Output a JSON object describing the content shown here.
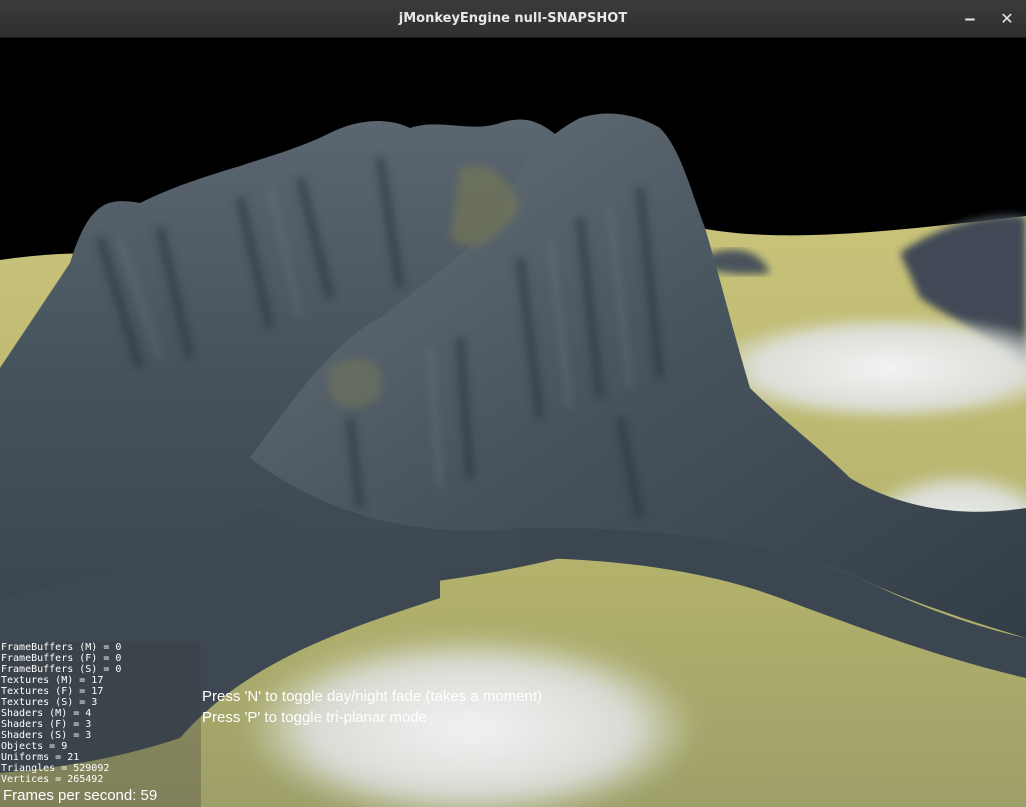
{
  "window": {
    "title": "jMonkeyEngine null-SNAPSHOT",
    "minimize_icon": "minimize-icon",
    "close_icon": "close-icon",
    "minimize_glyph": "‒",
    "close_glyph": "✕"
  },
  "stats": [
    "FrameBuffers (M) = 0",
    "FrameBuffers (F) = 0",
    "FrameBuffers (S) = 0",
    "Textures (M) = 17",
    "Textures (F) = 17",
    "Textures (S) = 3",
    "Shaders (M) = 4",
    "Shaders (F) = 3",
    "Shaders (S) = 3",
    "Objects = 9",
    "Uniforms = 21",
    "Triangles = 529092",
    "Vertices = 265492"
  ],
  "fps_text": "Frames per second: 59",
  "hints": [
    "Press 'N' to toggle day/night fade (takes a moment)",
    "Press 'P' to toggle tri-planar mode"
  ],
  "colors": {
    "sky": "#000000",
    "grass": "#b8b56a",
    "snow": "#e4e6e6",
    "rock": "#4a5561",
    "rock_dark": "#2c343c",
    "text": "#ffffff"
  }
}
